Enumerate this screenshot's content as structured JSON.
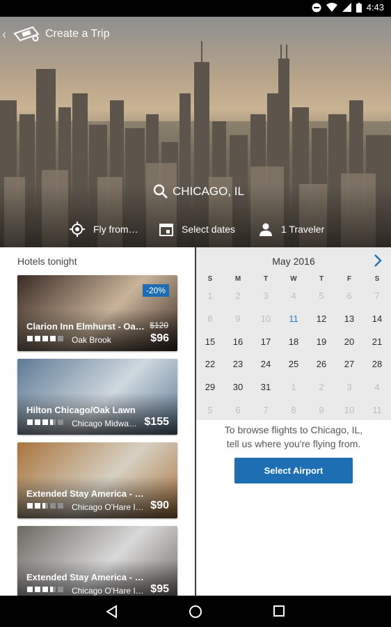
{
  "status_bar": {
    "time": "4:43"
  },
  "header": {
    "title": "Create a Trip"
  },
  "destination": {
    "label": "CHICAGO, IL"
  },
  "quick_bar": {
    "fly_from": "Fly from…",
    "dates": "Select dates",
    "travelers": "1 Traveler"
  },
  "hotels": {
    "heading": "Hotels tonight",
    "items": [
      {
        "name": "Clarion Inn Elmhurst - Oak…",
        "location": "Oak Brook",
        "price": "$96",
        "old_price": "$120",
        "badge": "-20%",
        "stars": 4,
        "photo_colors": [
          "#3a2a24",
          "#c9b49a"
        ]
      },
      {
        "name": "Hilton Chicago/Oak Lawn",
        "location": "Chicago Midwa…",
        "price": "$155",
        "stars": 3.5,
        "photo_colors": [
          "#5f7a95",
          "#cfd8de"
        ]
      },
      {
        "name": "Extended Stay America - …",
        "location": "Chicago O'Hare In…",
        "price": "$90",
        "stars": 2.5,
        "photo_colors": [
          "#a8753f",
          "#d7d0c2"
        ]
      },
      {
        "name": "Extended Stay America - …",
        "location": "Chicago O'Hare In…",
        "price": "$95",
        "stars": 3.5,
        "photo_colors": [
          "#6c6962",
          "#d9d9d9"
        ]
      }
    ]
  },
  "calendar": {
    "month": "May 2016",
    "weekdays": [
      "S",
      "M",
      "T",
      "W",
      "T",
      "F",
      "S"
    ],
    "today": 11,
    "weeks": [
      [
        {
          "d": "1",
          "s": "off"
        },
        {
          "d": "2",
          "s": "off"
        },
        {
          "d": "3",
          "s": "off"
        },
        {
          "d": "4",
          "s": "off"
        },
        {
          "d": "5",
          "s": "off"
        },
        {
          "d": "6",
          "s": "off"
        },
        {
          "d": "7",
          "s": "off"
        }
      ],
      [
        {
          "d": "8",
          "s": "off"
        },
        {
          "d": "9",
          "s": "off"
        },
        {
          "d": "10",
          "s": "off"
        },
        {
          "d": "11",
          "s": "today"
        },
        {
          "d": "12",
          "s": "on"
        },
        {
          "d": "13",
          "s": "on"
        },
        {
          "d": "14",
          "s": "on"
        }
      ],
      [
        {
          "d": "15",
          "s": "on"
        },
        {
          "d": "16",
          "s": "on"
        },
        {
          "d": "17",
          "s": "on"
        },
        {
          "d": "18",
          "s": "on"
        },
        {
          "d": "19",
          "s": "on"
        },
        {
          "d": "20",
          "s": "on"
        },
        {
          "d": "21",
          "s": "on"
        }
      ],
      [
        {
          "d": "22",
          "s": "on"
        },
        {
          "d": "23",
          "s": "on"
        },
        {
          "d": "24",
          "s": "on"
        },
        {
          "d": "25",
          "s": "on"
        },
        {
          "d": "26",
          "s": "on"
        },
        {
          "d": "27",
          "s": "on"
        },
        {
          "d": "28",
          "s": "on"
        }
      ],
      [
        {
          "d": "29",
          "s": "on"
        },
        {
          "d": "30",
          "s": "on"
        },
        {
          "d": "31",
          "s": "on"
        },
        {
          "d": "1",
          "s": "off"
        },
        {
          "d": "2",
          "s": "off"
        },
        {
          "d": "3",
          "s": "off"
        },
        {
          "d": "4",
          "s": "off"
        }
      ],
      [
        {
          "d": "5",
          "s": "off"
        },
        {
          "d": "6",
          "s": "off"
        },
        {
          "d": "7",
          "s": "off"
        },
        {
          "d": "8",
          "s": "off"
        },
        {
          "d": "9",
          "s": "off"
        },
        {
          "d": "10",
          "s": "off"
        },
        {
          "d": "11",
          "s": "off"
        }
      ]
    ],
    "colors": {
      "active": "#2a2a2a",
      "inactive": "#bdbdbd",
      "today": "#2f7ac4"
    }
  },
  "flights": {
    "message_line1": "To browse flights to Chicago, IL,",
    "message_line2": "tell us where you're flying from.",
    "button": "Select Airport"
  },
  "colors": {
    "accent": "#1d6eb3",
    "badge": "#1c6db3"
  }
}
